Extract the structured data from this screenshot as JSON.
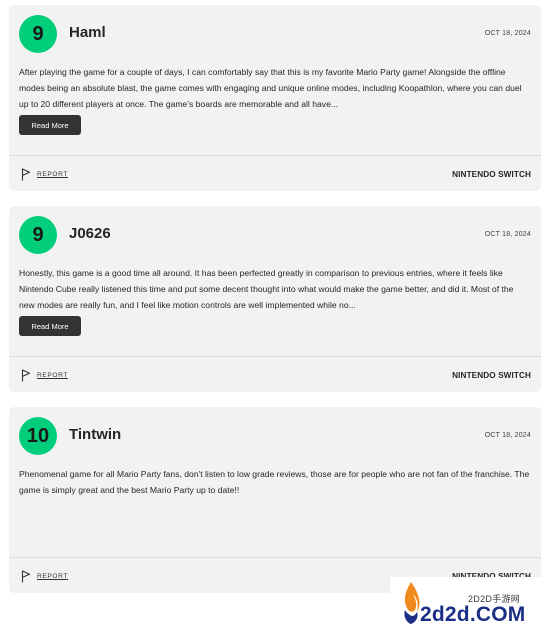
{
  "reviews": [
    {
      "score": "9",
      "username": "Haml",
      "date": "OCT 18, 2024",
      "text": "After playing the game for a couple of days, I can comfortably say that this is my favorite Mario Party game! Alongside the offline modes being an absolute blast, the game comes with engaging and unique online modes, including Koopathlon, where you can duel up to 20 different players at once. The game's boards are memorable and all have...",
      "read_more": "Read More",
      "report": "REPORT",
      "platform": "NINTENDO SWITCH"
    },
    {
      "score": "9",
      "username": "J0626",
      "date": "OCT 18, 2024",
      "text": "Honestly, this game is a good time all around. It has been perfected greatly in comparison to previous entries, where it feels like Nintendo Cube really listened this time and put some decent thought into what would make the game better, and did it. Most of the new modes are really fun, and I feel like motion controls are well implemented while no...",
      "read_more": "Read More",
      "report": "REPORT",
      "platform": "NINTENDO SWITCH"
    },
    {
      "score": "10",
      "username": "Tintwin",
      "date": "OCT 18, 2024",
      "text": "Phenomenal game for all Mario Party fans, don't listen to low grade reviews, those are for people who are not fan of the franchise. The game is simply great and the best Mario Party up to date!!",
      "report": "REPORT",
      "platform": "NINTENDO SWITCH"
    }
  ],
  "watermark": {
    "top_text": "2D2D手游网",
    "main_text": "2d2d.COM"
  },
  "colors": {
    "score_badge": "#00ce7a",
    "card_bg": "#f2f2f2",
    "read_more_bg": "#333333",
    "watermark_text": "#1c2f86"
  }
}
